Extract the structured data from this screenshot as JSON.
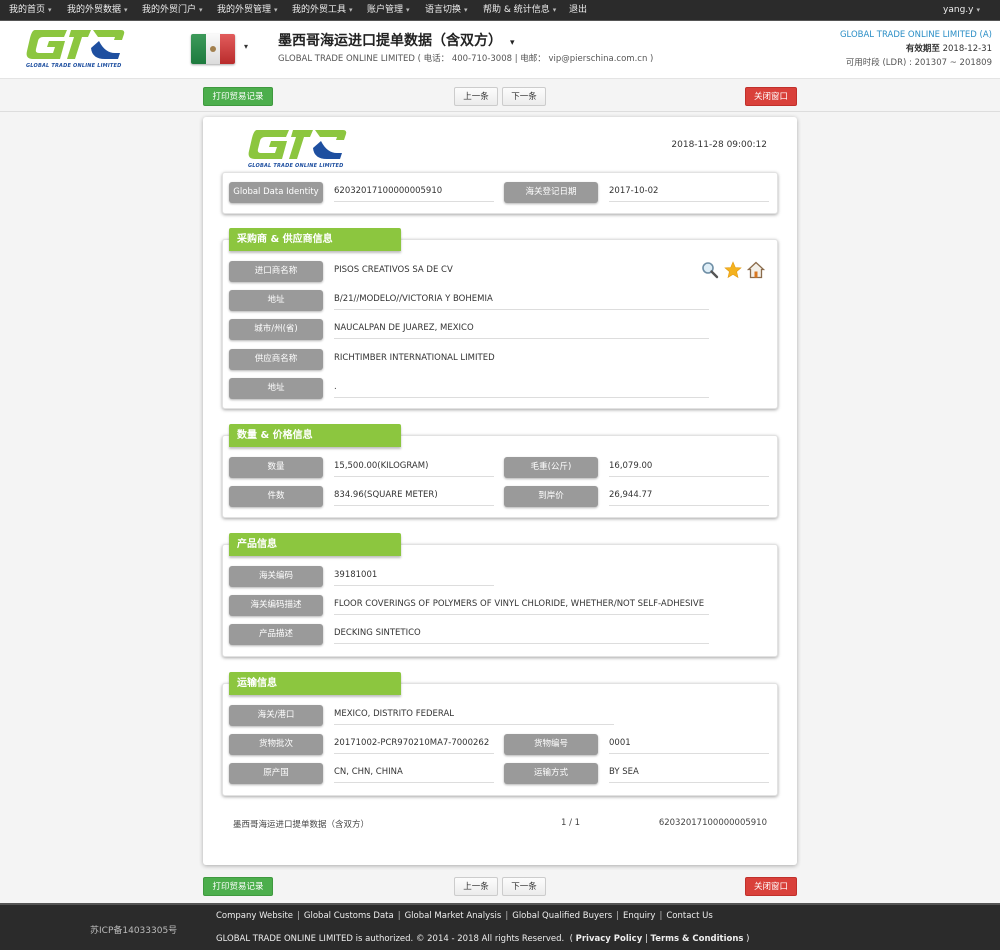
{
  "topnav": {
    "items": [
      {
        "label": "我的首页",
        "has_caret": true
      },
      {
        "label": "我的外贸数据",
        "has_caret": true
      },
      {
        "label": "我的外贸门户",
        "has_caret": true
      },
      {
        "label": "我的外贸管理",
        "has_caret": true
      },
      {
        "label": "我的外贸工具",
        "has_caret": true
      },
      {
        "label": "账户管理",
        "has_caret": true
      },
      {
        "label": "语言切换",
        "has_caret": true
      },
      {
        "label": "帮助 & 统计信息",
        "has_caret": true
      },
      {
        "label": "退出",
        "has_caret": false
      }
    ],
    "user": "yang.y",
    "caret": "▾"
  },
  "header": {
    "logo_text": "GTC",
    "logo_tagline": "GLOBAL TRADE  ONLINE LIMITED",
    "flag": "mexico-flag",
    "title": "墨西哥海运进口提单数据（含双方）",
    "subtitle": "GLOBAL TRADE ONLINE LIMITED ( 电话： 400-710-3008 | 电邮： vip@pierschina.com.cn )",
    "company": "GLOBAL TRADE ONLINE LIMITED (A)",
    "expiry_label": "有效期至",
    "expiry_date": "2018-12-31",
    "ldr_label": "可用时段 (LDR) :",
    "ldr_range": "201307 ~ 201809"
  },
  "actions": {
    "print": "打印贸易记录",
    "prev": "上一条",
    "next": "下一条",
    "close": "关闭窗口"
  },
  "record": {
    "timestamp": "2018-11-28 09:00:12",
    "identity": {
      "label": "Global Data Identity",
      "value": "62032017100000005910",
      "date_label": "海关登记日期",
      "date_value": "2017-10-02"
    },
    "parties": {
      "title": "采购商 & 供应商信息",
      "fields": [
        {
          "label": "进口商名称",
          "value": "PISOS CREATIVOS SA DE CV"
        },
        {
          "label": "地址",
          "value": "B/21//MODELO//VICTORIA Y BOHEMIA"
        },
        {
          "label": "城市/州(省)",
          "value": "NAUCALPAN DE JUAREZ, MEXICO"
        },
        {
          "label": "供应商名称",
          "value": "RICHTIMBER INTERNATIONAL LIMITED"
        },
        {
          "label": "地址",
          "value": "."
        }
      ],
      "icons": [
        "search-icon",
        "star-icon",
        "home-icon"
      ]
    },
    "quantity": {
      "title": "数量 & 价格信息",
      "fields": [
        {
          "label": "数量",
          "value": "15,500.00(KILOGRAM)"
        },
        {
          "label": "毛重(公斤)",
          "value": "16,079.00"
        },
        {
          "label": "件数",
          "value": "834.96(SQUARE METER)"
        },
        {
          "label": "到岸价",
          "value": "26,944.77"
        }
      ]
    },
    "product": {
      "title": "产品信息",
      "fields": [
        {
          "label": "海关编码",
          "value": "39181001"
        },
        {
          "label": "海关编码描述",
          "value": "FLOOR COVERINGS OF POLYMERS OF VINYL CHLORIDE, WHETHER/NOT SELF-ADHESIVE"
        },
        {
          "label": "产品描述",
          "value": "DECKING SINTETICO"
        }
      ]
    },
    "transport": {
      "title": "运输信息",
      "fields": [
        {
          "label": "海关/港口",
          "value": "MEXICO, DISTRITO FEDERAL"
        },
        {
          "label": "货物批次",
          "value": "20171002-PCR970210MA7-7000262"
        },
        {
          "label": "货物编号",
          "value": "0001"
        },
        {
          "label": "原产国",
          "value": "CN, CHN, CHINA"
        },
        {
          "label": "运输方式",
          "value": "BY SEA"
        }
      ]
    },
    "footer": {
      "dataset": "墨西哥海运进口提单数据（含双方）",
      "page": "1 / 1",
      "id": "62032017100000005910"
    }
  },
  "footer": {
    "icp": "苏ICP备14033305号",
    "links": [
      "Company Website",
      "Global Customs Data",
      "Global Market Analysis",
      "Global Qualified Buyers",
      "Enquiry",
      "Contact Us"
    ],
    "copyright": "GLOBAL TRADE ONLINE LIMITED is authorized. © 2014 - 2018 All rights Reserved.",
    "privacy": "Privacy Policy",
    "terms": "Terms & Conditions"
  },
  "colors": {
    "accent_green": "#8cc63f",
    "print_green": "#4cae4c",
    "close_red": "#d9403a",
    "label_gray": "#9a9a9a",
    "company_blue": "#2a8ec6"
  }
}
